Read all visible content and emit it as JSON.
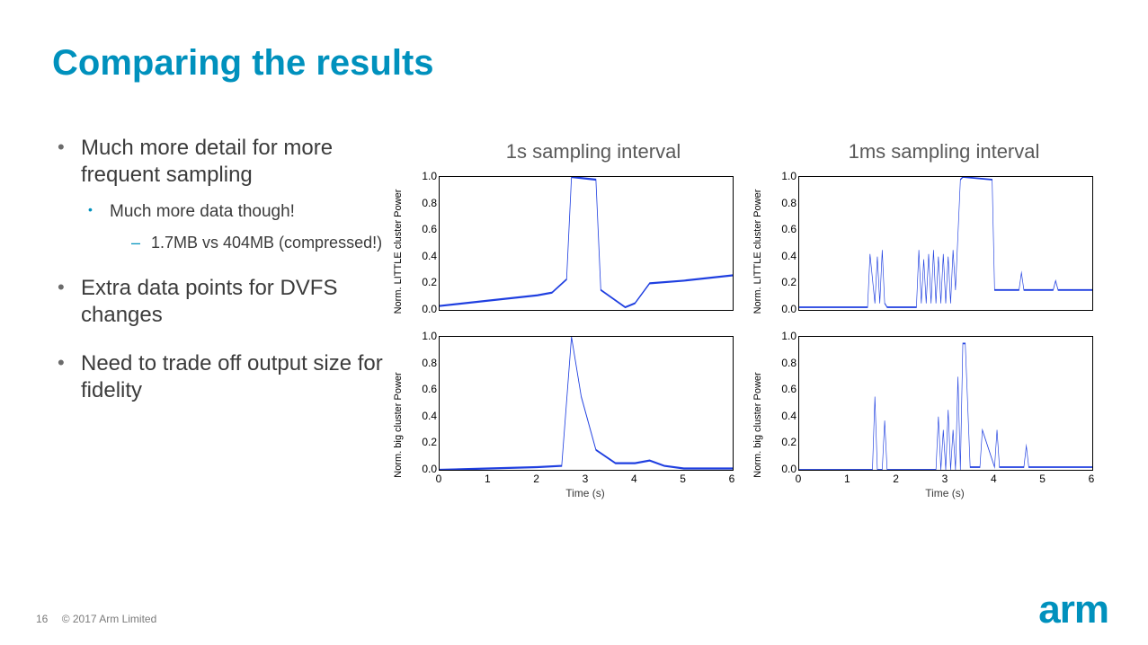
{
  "title": "Comparing the results",
  "bullets": [
    {
      "text": "Much more detail for more frequent sampling",
      "children": [
        {
          "text": "Much more data though!",
          "children": [
            {
              "text": "1.7MB vs 404MB (compressed!)"
            }
          ]
        }
      ]
    },
    {
      "text": "Extra data points for DVFS changes"
    },
    {
      "text": "Need to trade off output size for fidelity"
    }
  ],
  "footer": {
    "page": "16",
    "copyright": "© 2017 Arm Limited",
    "logo": "arm"
  },
  "chart_data": [
    {
      "type": "line",
      "title": "1s sampling interval",
      "ylabel": "Norm. LITTLE cluster Power",
      "xlabel": "Time (s)",
      "xlim": [
        0,
        6
      ],
      "ylim": [
        0,
        1
      ],
      "x": [
        0.0,
        1.0,
        2.0,
        2.3,
        2.6,
        2.7,
        3.2,
        3.3,
        3.8,
        4.0,
        4.3,
        5.0,
        6.0
      ],
      "y": [
        0.03,
        0.07,
        0.11,
        0.13,
        0.23,
        1.0,
        0.98,
        0.15,
        0.02,
        0.05,
        0.2,
        0.22,
        0.26
      ]
    },
    {
      "type": "line",
      "title": "1s sampling interval",
      "ylabel": "Norm. big cluster Power",
      "xlabel": "Time (s)",
      "xlim": [
        0,
        6
      ],
      "ylim": [
        0,
        1
      ],
      "x": [
        0.0,
        1.0,
        2.0,
        2.5,
        2.7,
        2.9,
        3.2,
        3.6,
        4.0,
        4.3,
        4.6,
        5.0,
        6.0
      ],
      "y": [
        0.0,
        0.01,
        0.02,
        0.03,
        1.0,
        0.55,
        0.15,
        0.05,
        0.05,
        0.07,
        0.03,
        0.01,
        0.01
      ]
    },
    {
      "type": "line",
      "title": "1ms sampling interval",
      "ylabel": "Norm. LITTLE cluster Power",
      "xlabel": "Time (s)",
      "xlim": [
        0,
        6
      ],
      "ylim": [
        0,
        1
      ],
      "x": [
        0.0,
        0.5,
        1.0,
        1.4,
        1.45,
        1.55,
        1.6,
        1.65,
        1.7,
        1.75,
        1.8,
        2.0,
        2.4,
        2.45,
        2.5,
        2.55,
        2.6,
        2.65,
        2.7,
        2.75,
        2.8,
        2.85,
        2.9,
        2.95,
        3.0,
        3.05,
        3.1,
        3.15,
        3.2,
        3.3,
        3.35,
        3.95,
        4.0,
        4.1,
        4.3,
        4.5,
        4.55,
        4.6,
        5.0,
        5.2,
        5.25,
        5.3,
        6.0
      ],
      "y": [
        0.02,
        0.02,
        0.02,
        0.02,
        0.42,
        0.05,
        0.4,
        0.05,
        0.45,
        0.05,
        0.02,
        0.02,
        0.02,
        0.45,
        0.05,
        0.38,
        0.05,
        0.42,
        0.05,
        0.45,
        0.05,
        0.4,
        0.05,
        0.42,
        0.05,
        0.4,
        0.05,
        0.45,
        0.15,
        0.98,
        1.0,
        0.98,
        0.15,
        0.15,
        0.15,
        0.15,
        0.28,
        0.15,
        0.15,
        0.15,
        0.22,
        0.15,
        0.15
      ]
    },
    {
      "type": "line",
      "title": "1ms sampling interval",
      "ylabel": "Norm. big cluster Power",
      "xlabel": "Time (s)",
      "xlim": [
        0,
        6
      ],
      "ylim": [
        0,
        1
      ],
      "x": [
        0.0,
        0.5,
        1.0,
        1.5,
        1.55,
        1.6,
        1.7,
        1.75,
        1.8,
        2.0,
        2.6,
        2.8,
        2.85,
        2.9,
        2.95,
        3.0,
        3.05,
        3.1,
        3.15,
        3.2,
        3.25,
        3.3,
        3.35,
        3.4,
        3.5,
        3.7,
        3.75,
        4.0,
        4.05,
        4.1,
        4.6,
        4.65,
        4.7,
        5.0,
        6.0
      ],
      "y": [
        0.0,
        0.0,
        0.0,
        0.0,
        0.55,
        0.0,
        0.0,
        0.37,
        0.0,
        0.0,
        0.0,
        0.0,
        0.4,
        0.0,
        0.3,
        0.0,
        0.45,
        0.0,
        0.3,
        0.0,
        0.7,
        0.0,
        0.95,
        0.95,
        0.02,
        0.02,
        0.3,
        0.02,
        0.3,
        0.02,
        0.02,
        0.18,
        0.02,
        0.02,
        0.02
      ]
    }
  ]
}
